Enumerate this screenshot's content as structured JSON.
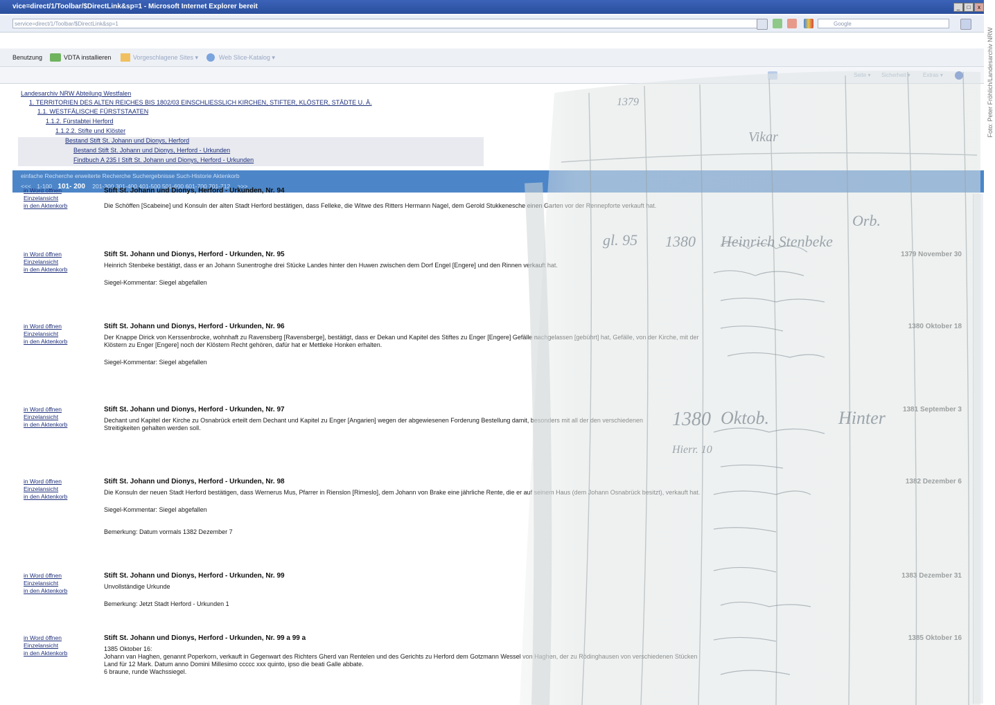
{
  "window": {
    "title": "vice=direct/1/Toolbar/$DirectLink&sp=1 - Microsoft Internet Explorer bereit",
    "controls": [
      "_",
      "□",
      "x"
    ]
  },
  "address_bar": {
    "url": "service=direct/1/Toolbar/$DirectLink&sp=1",
    "search_placeholder": "Google"
  },
  "links_bar": {
    "items": [
      "Benutzung",
      "VDTA installieren",
      "Vorgeschlagene Sites ▾",
      "Web Slice-Katalog ▾"
    ]
  },
  "command_bar": {
    "items": [
      "Seite ▾",
      "Sicherheit ▾",
      "Extras ▾"
    ]
  },
  "tree": {
    "items": [
      "Landesarchiv NRW Abteilung Westfalen",
      "1. TERRITORIEN DES ALTEN REICHES BIS 1802/03 EINSCHLIESSLICH KIRCHEN, STIFTER, KLÖSTER, STÄDTE U. Ä.",
      "1.1. WESTFÄLISCHE FÜRSTSTAATEN",
      "1.1.2. Fürstabtei Herford",
      "1.1.2.2. Stifte und Klöster",
      "Bestand Stift St. Johann und Dionys, Herford",
      "Bestand Stift St. Johann und Dionys, Herford - Urkunden",
      "Findbuch A 235 I Stift St. Johann und Dionys, Herford - Urkunden"
    ]
  },
  "nav": {
    "tabs": "einfache Recherche  erweiterte Recherche  Suchergebnisse  Such-Historie  Aktenkorb",
    "prev": "<<<",
    "page_first": "1-100",
    "page_current": "101- 200",
    "pages_rest": "201-300   301-400   401-500   501-600   601-700   701-712",
    "next": ">>>"
  },
  "record_links": [
    "in Word öffnen",
    "Einzelansicht",
    "in den Aktenkorb"
  ],
  "records": [
    {
      "title": "Stift St. Johann und Dionys, Herford - Urkunden, Nr. 94",
      "date": "",
      "desc": [
        "Die Schöffen [Scabeine] und Konsuln der alten Stadt Herford bestätigen, dass Felleke, die Witwe des Ritters Hermann Nagel, dem Gerold Stukkenesche einen Garten vor der Rennepforte verkauft hat."
      ],
      "lines": []
    },
    {
      "title": "Stift St. Johann und Dionys, Herford - Urkunden, Nr. 95",
      "date": "1379 November 30",
      "desc": [
        "Heinrich Stenbeke bestätigt, dass er an Johann Sunentroghe drei Stücke Landes hinter den Huwen zwischen dem Dorf Engel [Engere] und den Rinnen verkauft hat."
      ],
      "lines": [
        "Siegel-Kommentar: Siegel abgefallen"
      ]
    },
    {
      "title": "Stift St. Johann und Dionys, Herford - Urkunden, Nr. 96",
      "date": "1380 Oktober 18",
      "desc": [
        "Der Knappe Dirick von Kerssenbrocke, wohnhaft zu Ravensberg [Ravensberge], bestätigt, dass er Dekan und Kapitel des Stiftes zu Enger [Engere] Gefälle nachgelassen [gebührt] hat, Gefälle, von der Kirche, mit der",
        "Klöstern zu Enger [Engere] noch der Klöstern Recht gehören, dafür hat er Mettleke Honken erhalten."
      ],
      "lines": [
        "Siegel-Kommentar: Siegel abgefallen"
      ]
    },
    {
      "title": "Stift St. Johann und Dionys, Herford - Urkunden, Nr. 97",
      "date": "1381 September 3",
      "desc": [
        "Dechant und Kapitel der Kirche zu Osnabrück erteilt dem Dechant und Kapitel zu Enger [Angarien] wegen der abgewiesenen Forderung  Bestellung damit, besonders mit all der den verschiedenen",
        "Streitigkeiten gehalten werden soll."
      ],
      "lines": []
    },
    {
      "title": "Stift St. Johann und Dionys, Herford - Urkunden, Nr. 98",
      "date": "1382 Dezember 6",
      "desc": [
        "Die Konsuln der neuen Stadt Herford bestätigen, dass Wernerus Mus, Pfarrer in Rienslon [Rimeslo], dem Johann von Brake eine jährliche Rente, die er auf seinem Haus (dem Johann Osnabrück besitzt), verkauft hat."
      ],
      "lines": [
        "Siegel-Kommentar: Siegel abgefallen",
        "Bemerkung: Datum vormals 1382 Dezember 7"
      ]
    },
    {
      "title": "Stift St. Johann und Dionys, Herford - Urkunden, Nr. 99",
      "date": "1383 Dezember 31",
      "desc": [
        "Unvollständige Urkunde"
      ],
      "lines": [
        "Bemerkung: Jetzt Stadt Herford - Urkunden 1"
      ]
    },
    {
      "title": "Stift St. Johann und Dionys, Herford - Urkunden, Nr. 99 a 99 a",
      "date": "1385 Oktober 16",
      "desc": [
        "1385 Oktober 16:",
        "Johann van Haghen, genannt Poperkorn, verkauft in Gegenwart des Richters Gherd van Rentelen und des Gerichts zu Herford dem Gotzmann Wessel von Haghen, der zu Rödinghausen von verschiedenen Stücken",
        "Land für 12 Mark. Datum anno Domini Millesimo ccccc xxx quinto, ipso die beati Galle abbate.",
        "6 braune, runde Wachssiegel."
      ],
      "lines": []
    }
  ],
  "credit": "Foto: Peter Fröhlich/Landesarchiv NRW",
  "manuscript": {
    "year_mid": "1380",
    "year_top": "1379",
    "notes": [
      "gl. 95",
      "Heinrich Stenbeke",
      "Hinter",
      "Orb.",
      "1380",
      "Hierr. 10",
      "Oktob.",
      "Vikar"
    ]
  }
}
